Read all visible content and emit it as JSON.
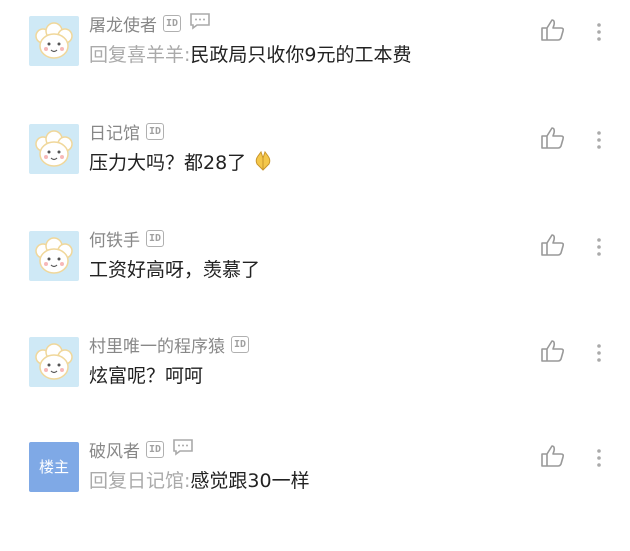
{
  "comments": [
    {
      "user": "屠龙使者",
      "id_badge": "ID",
      "reply_prefix": "回复喜羊羊:",
      "text": "民政局只收你9元的工本费"
    },
    {
      "user": "日记馆",
      "id_badge": "ID",
      "reply_prefix": "",
      "text": "压力大吗？都28了",
      "emoji": "folded-hands-emoji"
    },
    {
      "user": "何铁手",
      "id_badge": "ID",
      "reply_prefix": "",
      "text": "工资好高呀，羡慕了"
    },
    {
      "user": "村里唯一的程序猿",
      "id_badge": "ID",
      "reply_prefix": "",
      "text": "炫富呢？呵呵"
    },
    {
      "user": "破风者",
      "id_badge": "ID",
      "avatar_label": "楼主",
      "reply_prefix": "回复日记馆:",
      "text": "感觉跟30一样"
    }
  ],
  "icons": {
    "like": "thumbs-up-icon",
    "more": "more-vertical-icon",
    "chat": "chat-bubble-icon",
    "avatar": "sheep-avatar-icon"
  },
  "colors": {
    "avatar_bg": "#cfe9f6",
    "host_avatar_bg": "#7fa9e6",
    "name_gray": "#888888",
    "text": "#222222"
  }
}
